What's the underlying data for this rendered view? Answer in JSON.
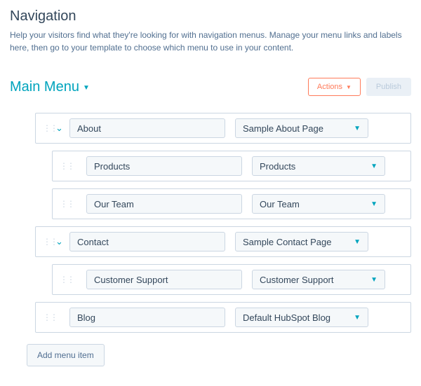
{
  "header": {
    "title": "Navigation",
    "subtitle": "Help your visitors find what they're looking for with navigation menus. Manage your menu links and labels here, then go to your template to choose which menu to use in your content."
  },
  "toolbar": {
    "menu_name": "Main Menu",
    "actions_label": "Actions",
    "publish_label": "Publish"
  },
  "items": [
    {
      "label": "About",
      "page": "Sample About Page",
      "level": 0,
      "expandable": true
    },
    {
      "label": "Products",
      "page": "Products",
      "level": 1,
      "expandable": false
    },
    {
      "label": "Our Team",
      "page": "Our Team",
      "level": 1,
      "expandable": false
    },
    {
      "label": "Contact",
      "page": "Sample Contact Page",
      "level": 0,
      "expandable": true
    },
    {
      "label": "Customer Support",
      "page": "Customer Support",
      "level": 1,
      "expandable": false
    },
    {
      "label": "Blog",
      "page": "Default HubSpot Blog",
      "level": 0,
      "expandable": false
    }
  ],
  "add_item_label": "Add menu item"
}
